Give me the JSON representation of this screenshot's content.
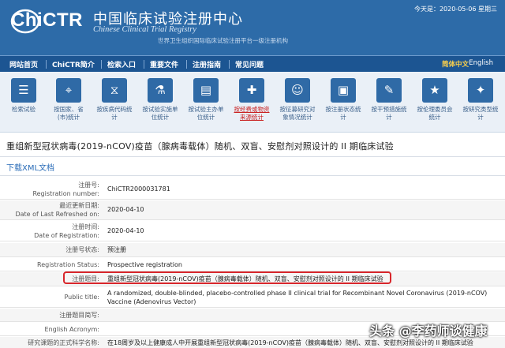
{
  "header": {
    "logo_text": "ChiCTR",
    "cn_title": "中国临床试验注册中心",
    "en_title": "Chinese Clinical Trial Registry",
    "sub_title": "世界卫生组织国际临床试验注册平台一级注册机构",
    "date": "今天是：2020-05-06 星期三"
  },
  "nav": {
    "items": [
      "网站首页",
      "ChiCTR简介",
      "检索入口",
      "重要文件",
      "注册指南",
      "常见问题"
    ],
    "lang_cn": "简体中文",
    "lang_en": "English"
  },
  "tiles": [
    {
      "icon": "list-icon",
      "glyph": "☰",
      "l1": "检索试验",
      "l2": ""
    },
    {
      "icon": "map-icon",
      "glyph": "⌖",
      "l1": "按国家、省",
      "l2": "(市)统计"
    },
    {
      "icon": "dna-icon",
      "glyph": "⧖",
      "l1": "按疾病代码统",
      "l2": "计"
    },
    {
      "icon": "flask-icon",
      "glyph": "⚗",
      "l1": "按试验实施单",
      "l2": "位统计"
    },
    {
      "icon": "clipboard-icon",
      "glyph": "▤",
      "l1": "按试验主办单",
      "l2": "位统计"
    },
    {
      "icon": "medkit-icon",
      "glyph": "✚",
      "l1": "按经费或物资",
      "l2": "来源统计",
      "red": true
    },
    {
      "icon": "people-icon",
      "glyph": "☺",
      "l1": "按征募研究对",
      "l2": "象情况统计"
    },
    {
      "icon": "status-icon",
      "glyph": "▣",
      "l1": "按注册状态统",
      "l2": "计"
    },
    {
      "icon": "intervention-icon",
      "glyph": "✎",
      "l1": "按干预措施统",
      "l2": "计"
    },
    {
      "icon": "ethics-icon",
      "glyph": "★",
      "l1": "按伦理委员会",
      "l2": "统计"
    },
    {
      "icon": "study-type-icon",
      "glyph": "✦",
      "l1": "按研究类型统",
      "l2": "计"
    }
  ],
  "page_title": "重组新型冠状病毒(2019-nCOV)疫苗（腺病毒载体）随机、双盲、安慰剂对照设计的 II 期临床试验",
  "xml_link": "下载XML文档",
  "rows": [
    {
      "cn": "注册号:",
      "en": "Registration number:",
      "val": "ChiCTR2000031781"
    },
    {
      "cn": "最近更新日期:",
      "en": "Date of Last Refreshed on:",
      "val": "2020-04-10"
    },
    {
      "cn": "注册时间:",
      "en": "Date of Registration:",
      "val": "2020-04-10"
    },
    {
      "cn": "",
      "en": "注册号状态:",
      "val": "预注册"
    },
    {
      "cn": "",
      "en": "Registration Status:",
      "val": "Prospective registration"
    },
    {
      "cn": "",
      "en": "注册题目:",
      "val": "重组新型冠状病毒(2019-nCOV)疫苗（腺病毒载体）随机、双盲、安慰剂对照设计的 II 期临床试验"
    },
    {
      "cn": "",
      "en": "Public title:",
      "val": "A randomized, double-blinded, placebo-controlled phase II clinical trial for Recombinant Novel Coronavirus (2019-nCOV)",
      "val2": "Vaccine (Adenovirus Vector)"
    },
    {
      "cn": "",
      "en": "注册题目简写:",
      "val": ""
    },
    {
      "cn": "",
      "en": "English Acronym:",
      "val": ""
    },
    {
      "cn": "",
      "en": "研究课题的正式科学名称:",
      "val": "在18周岁及以上健康成人中开展重组新型冠状病毒(2019-nCOV)疫苗（腺病毒载体）随机、双盲、安慰剂对照设计的 II 期临床试验"
    }
  ],
  "watermark": "头条 @李药师谈健康"
}
